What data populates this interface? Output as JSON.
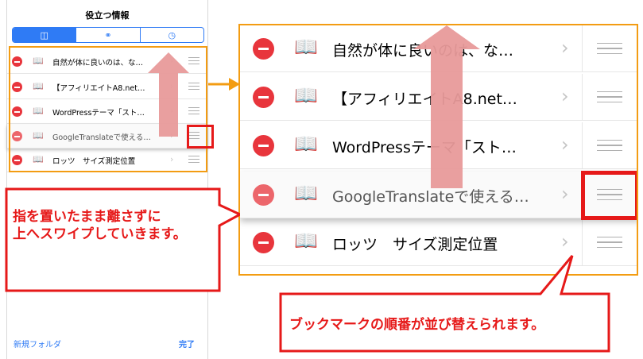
{
  "phone": {
    "title": "役立つ情報",
    "segments": [
      {
        "icon": "book-icon",
        "glyph": "📖"
      },
      {
        "icon": "glasses-icon",
        "glyph": "⚯"
      },
      {
        "icon": "clock-icon",
        "glyph": "◷"
      }
    ],
    "rows": [
      {
        "label": "自然が体に良いのは、な…"
      },
      {
        "label": "【アフィリエイトA8.net…"
      },
      {
        "label": "WordPressテーマ「スト…"
      },
      {
        "label": "GoogleTranslateで使える…"
      },
      {
        "label": "ロッツ　サイズ測定位置"
      }
    ],
    "new_folder": "新規フォルダ",
    "done": "完了"
  },
  "zoom": {
    "rows": [
      {
        "label": "自然が体に良いのは、な…"
      },
      {
        "label": "【アフィリエイトA8.net…"
      },
      {
        "label": "WordPressテーマ「スト…"
      },
      {
        "label": "GoogleTranslateで使える…"
      },
      {
        "label": "ロッツ　サイズ測定位置"
      }
    ]
  },
  "callouts": {
    "left": "指を置いたまま離さずに\n上へスワイプしていきます。",
    "bottom": "ブックマークの順番が並び替えられます。"
  },
  "colors": {
    "accent": "#2f7bf5",
    "delete": "#e8353c",
    "highlight_red": "#e61919",
    "highlight_orange": "#f39c12",
    "arrow_pink": "#e89a9a"
  }
}
